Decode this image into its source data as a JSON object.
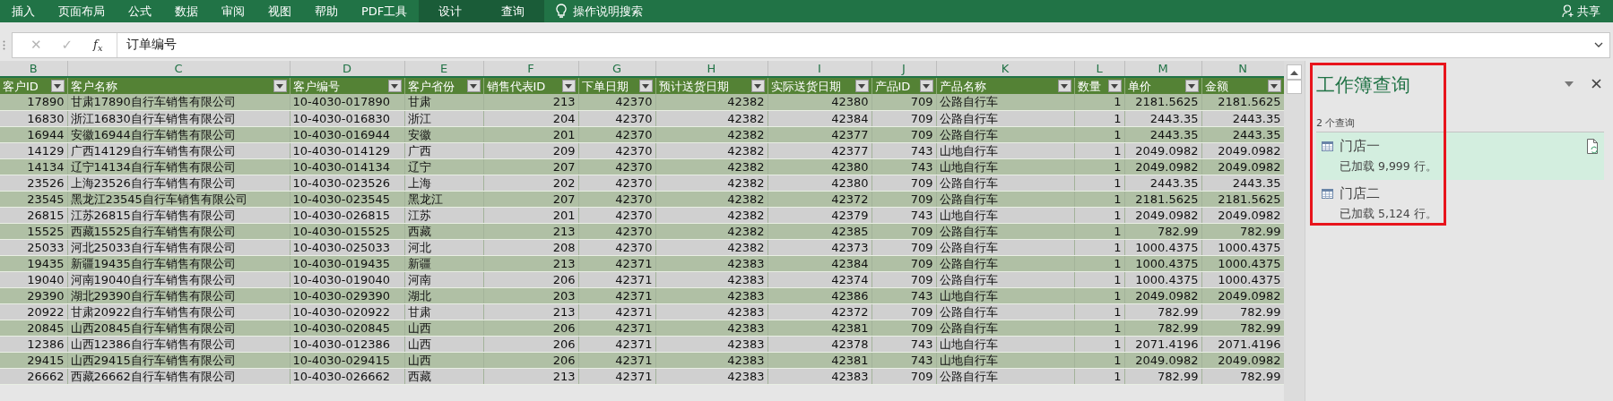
{
  "ribbon": {
    "tabs": [
      {
        "label": "插入",
        "contextual": false
      },
      {
        "label": "页面布局",
        "contextual": false
      },
      {
        "label": "公式",
        "contextual": false
      },
      {
        "label": "数据",
        "contextual": false
      },
      {
        "label": "审阅",
        "contextual": false
      },
      {
        "label": "视图",
        "contextual": false
      },
      {
        "label": "帮助",
        "contextual": false
      },
      {
        "label": "PDF工具",
        "contextual": false
      },
      {
        "label": "设计",
        "contextual": true
      },
      {
        "label": "查询",
        "contextual": true
      }
    ],
    "tell_me": "操作说明搜索",
    "share": "共享"
  },
  "formula_bar": {
    "cancel": "✕",
    "enter": "✓",
    "disabled": true,
    "function_label": "f$_{x}$",
    "value": "订单编号"
  },
  "sheet": {
    "columns": [
      {
        "letter": "B",
        "header": "客户ID",
        "kind": "number"
      },
      {
        "letter": "C",
        "header": "客户名称",
        "kind": "text"
      },
      {
        "letter": "D",
        "header": "客户编号",
        "kind": "text"
      },
      {
        "letter": "E",
        "header": "客户省份",
        "kind": "text"
      },
      {
        "letter": "F",
        "header": "销售代表ID",
        "kind": "number"
      },
      {
        "letter": "G",
        "header": "下单日期",
        "kind": "number"
      },
      {
        "letter": "H",
        "header": "预计送货日期",
        "kind": "number"
      },
      {
        "letter": "I",
        "header": "实际送货日期",
        "kind": "number"
      },
      {
        "letter": "J",
        "header": "产品ID",
        "kind": "number"
      },
      {
        "letter": "K",
        "header": "产品名称",
        "kind": "text"
      },
      {
        "letter": "L",
        "header": "数量",
        "kind": "number"
      },
      {
        "letter": "M",
        "header": "单价",
        "kind": "number"
      },
      {
        "letter": "N",
        "header": "金额",
        "kind": "number"
      }
    ],
    "rows": [
      [
        "17890",
        "甘肃17890自行车销售有限公司",
        "10-4030-017890",
        "甘肃",
        "213",
        "42370",
        "42382",
        "42380",
        "709",
        "公路自行车",
        "1",
        "2181.5625",
        "2181.5625"
      ],
      [
        "16830",
        "浙江16830自行车销售有限公司",
        "10-4030-016830",
        "浙江",
        "204",
        "42370",
        "42382",
        "42384",
        "709",
        "公路自行车",
        "1",
        "2443.35",
        "2443.35"
      ],
      [
        "16944",
        "安徽16944自行车销售有限公司",
        "10-4030-016944",
        "安徽",
        "201",
        "42370",
        "42382",
        "42377",
        "709",
        "公路自行车",
        "1",
        "2443.35",
        "2443.35"
      ],
      [
        "14129",
        "广西14129自行车销售有限公司",
        "10-4030-014129",
        "广西",
        "209",
        "42370",
        "42382",
        "42377",
        "743",
        "山地自行车",
        "1",
        "2049.0982",
        "2049.0982"
      ],
      [
        "14134",
        "辽宁14134自行车销售有限公司",
        "10-4030-014134",
        "辽宁",
        "207",
        "42370",
        "42382",
        "42380",
        "743",
        "山地自行车",
        "1",
        "2049.0982",
        "2049.0982"
      ],
      [
        "23526",
        "上海23526自行车销售有限公司",
        "10-4030-023526",
        "上海",
        "202",
        "42370",
        "42382",
        "42380",
        "709",
        "公路自行车",
        "1",
        "2443.35",
        "2443.35"
      ],
      [
        "23545",
        "黑龙江23545自行车销售有限公司",
        "10-4030-023545",
        "黑龙江",
        "207",
        "42370",
        "42382",
        "42372",
        "709",
        "公路自行车",
        "1",
        "2181.5625",
        "2181.5625"
      ],
      [
        "26815",
        "江苏26815自行车销售有限公司",
        "10-4030-026815",
        "江苏",
        "201",
        "42370",
        "42382",
        "42379",
        "743",
        "山地自行车",
        "1",
        "2049.0982",
        "2049.0982"
      ],
      [
        "15525",
        "西藏15525自行车销售有限公司",
        "10-4030-015525",
        "西藏",
        "213",
        "42370",
        "42382",
        "42385",
        "709",
        "公路自行车",
        "1",
        "782.99",
        "782.99"
      ],
      [
        "25033",
        "河北25033自行车销售有限公司",
        "10-4030-025033",
        "河北",
        "208",
        "42370",
        "42382",
        "42373",
        "709",
        "公路自行车",
        "1",
        "1000.4375",
        "1000.4375"
      ],
      [
        "19435",
        "新疆19435自行车销售有限公司",
        "10-4030-019435",
        "新疆",
        "213",
        "42371",
        "42383",
        "42384",
        "709",
        "公路自行车",
        "1",
        "1000.4375",
        "1000.4375"
      ],
      [
        "19040",
        "河南19040自行车销售有限公司",
        "10-4030-019040",
        "河南",
        "206",
        "42371",
        "42383",
        "42374",
        "709",
        "公路自行车",
        "1",
        "1000.4375",
        "1000.4375"
      ],
      [
        "29390",
        "湖北29390自行车销售有限公司",
        "10-4030-029390",
        "湖北",
        "203",
        "42371",
        "42383",
        "42386",
        "743",
        "山地自行车",
        "1",
        "2049.0982",
        "2049.0982"
      ],
      [
        "20922",
        "甘肃20922自行车销售有限公司",
        "10-4030-020922",
        "甘肃",
        "213",
        "42371",
        "42383",
        "42372",
        "709",
        "公路自行车",
        "1",
        "782.99",
        "782.99"
      ],
      [
        "20845",
        "山西20845自行车销售有限公司",
        "10-4030-020845",
        "山西",
        "206",
        "42371",
        "42383",
        "42381",
        "709",
        "公路自行车",
        "1",
        "782.99",
        "782.99"
      ],
      [
        "12386",
        "山西12386自行车销售有限公司",
        "10-4030-012386",
        "山西",
        "206",
        "42371",
        "42383",
        "42378",
        "743",
        "山地自行车",
        "1",
        "2071.4196",
        "2071.4196"
      ],
      [
        "29415",
        "山西29415自行车销售有限公司",
        "10-4030-029415",
        "山西",
        "206",
        "42371",
        "42383",
        "42381",
        "743",
        "山地自行车",
        "1",
        "2049.0982",
        "2049.0982"
      ],
      [
        "26662",
        "西藏26662自行车销售有限公司",
        "10-4030-026662",
        "西藏",
        "213",
        "42371",
        "42383",
        "42383",
        "709",
        "公路自行车",
        "1",
        "782.99",
        "782.99"
      ]
    ]
  },
  "queries_pane": {
    "title": "工作簿查询",
    "highlighted": true,
    "count": "2 个查询",
    "queries": [
      {
        "name": "门店一",
        "status": "已加载 9,999 行。",
        "selected": true
      },
      {
        "name": "门店二",
        "status": "已加载 5,124 行。",
        "selected": false
      }
    ]
  }
}
